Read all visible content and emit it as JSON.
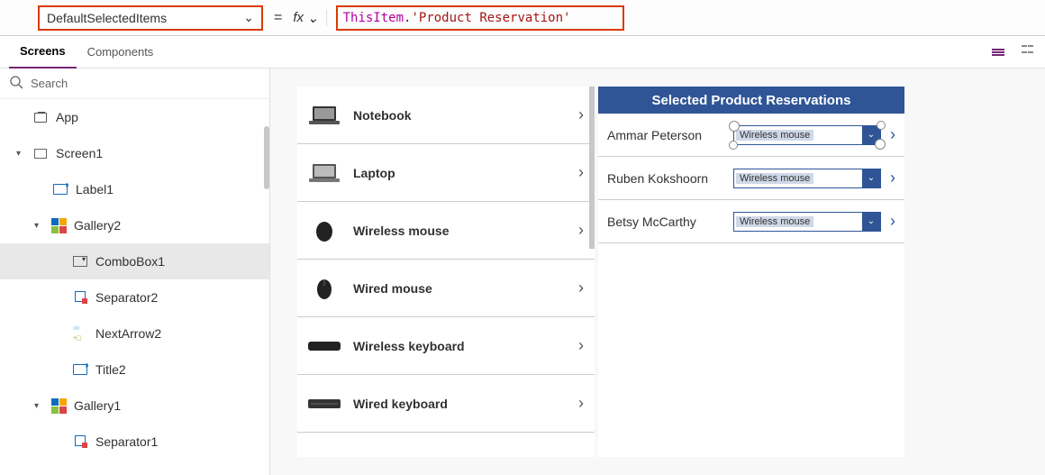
{
  "formula_bar": {
    "property": "DefaultSelectedItems",
    "fx_label": "fx",
    "equals": "=",
    "formula_keyword": "ThisItem",
    "formula_dot": ".",
    "formula_string": "'Product Reservation'"
  },
  "tabs": {
    "screens": "Screens",
    "components": "Components"
  },
  "search": {
    "placeholder": "Search"
  },
  "tree": {
    "app": "App",
    "screen1": "Screen1",
    "label1": "Label1",
    "gallery2": "Gallery2",
    "combobox1": "ComboBox1",
    "separator2": "Separator2",
    "nextarrow2": "NextArrow2",
    "title2": "Title2",
    "gallery1": "Gallery1",
    "separator1": "Separator1"
  },
  "products": [
    {
      "name": "Notebook",
      "icon": "laptop"
    },
    {
      "name": "Laptop",
      "icon": "laptop"
    },
    {
      "name": "Wireless mouse",
      "icon": "mouse"
    },
    {
      "name": "Wired mouse",
      "icon": "mouse"
    },
    {
      "name": "Wireless keyboard",
      "icon": "keyboard"
    },
    {
      "name": "Wired keyboard",
      "icon": "keyboard"
    }
  ],
  "reservations": {
    "header": "Selected Product Reservations",
    "rows": [
      {
        "name": "Ammar Peterson",
        "value": "Wireless mouse",
        "selected": true
      },
      {
        "name": "Ruben Kokshoorn",
        "value": "Wireless mouse",
        "selected": false
      },
      {
        "name": "Betsy McCarthy",
        "value": "Wireless mouse",
        "selected": false
      }
    ]
  }
}
